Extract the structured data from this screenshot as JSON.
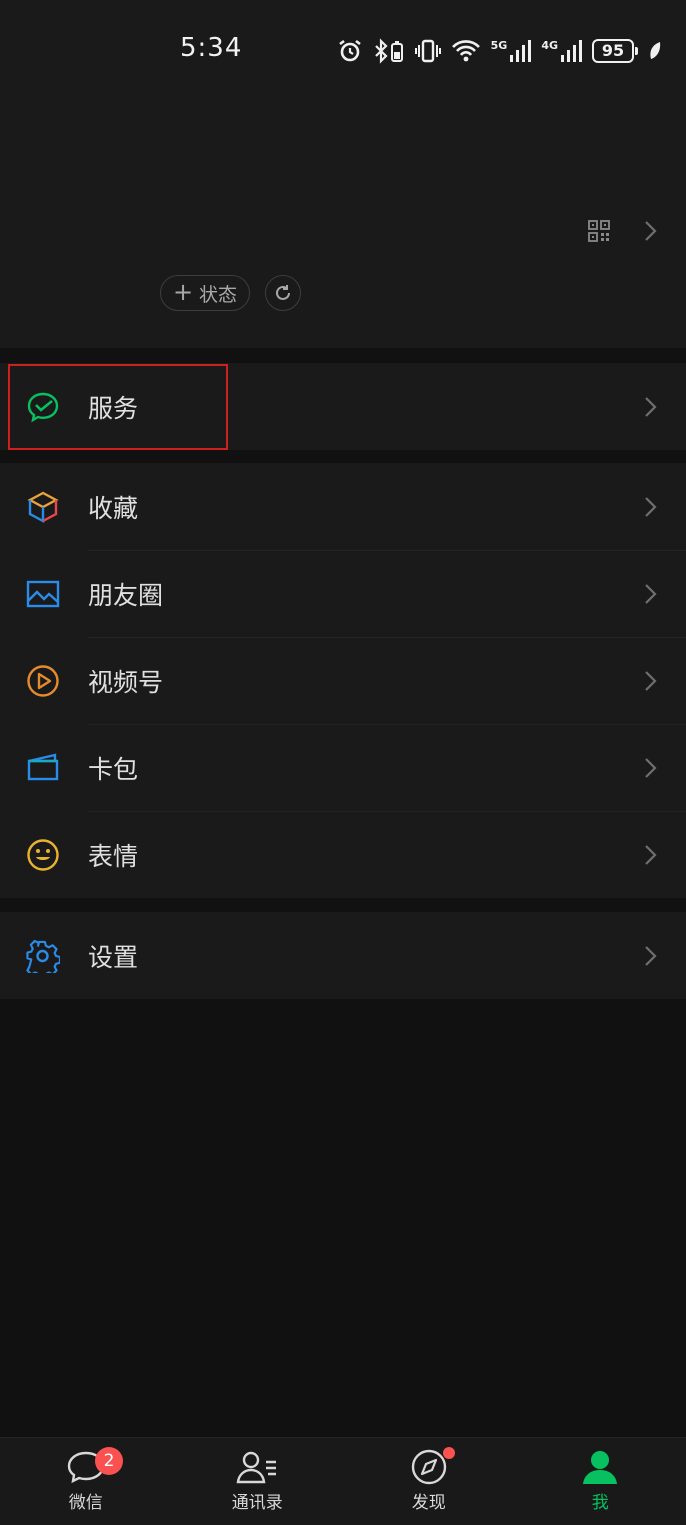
{
  "status_bar": {
    "time": "5:34",
    "network_5g": "5G",
    "network_4g": "4G",
    "battery": "95"
  },
  "profile": {
    "status_button_label": "状态"
  },
  "menu": {
    "group1": [
      {
        "label": "服务",
        "icon": "wechat-pay-icon",
        "color": "#07c160"
      }
    ],
    "group2": [
      {
        "label": "收藏",
        "icon": "favorites-cube-icon",
        "color": "#e8a33c"
      },
      {
        "label": "朋友圈",
        "icon": "moments-picture-icon",
        "color": "#2b8be8"
      },
      {
        "label": "视频号",
        "icon": "channels-play-icon",
        "color": "#e58b2e"
      },
      {
        "label": "卡包",
        "icon": "card-wallet-icon",
        "color": "#2b8be8"
      },
      {
        "label": "表情",
        "icon": "sticker-smiley-icon",
        "color": "#e8b32e"
      }
    ],
    "group3": [
      {
        "label": "设置",
        "icon": "settings-gear-icon",
        "color": "#2b8be8"
      }
    ]
  },
  "tab_bar": {
    "tabs": [
      {
        "label": "微信",
        "icon": "chat-bubble-icon",
        "badge": "2"
      },
      {
        "label": "通讯录",
        "icon": "contacts-icon"
      },
      {
        "label": "发现",
        "icon": "discover-compass-icon"
      },
      {
        "label": "我",
        "icon": "me-person-icon",
        "active": true
      }
    ]
  },
  "colors": {
    "accent": "#07c160",
    "badge": "#fa5151",
    "highlight": "#d0201e",
    "background": "#111111",
    "surface": "#1a1a1a"
  }
}
